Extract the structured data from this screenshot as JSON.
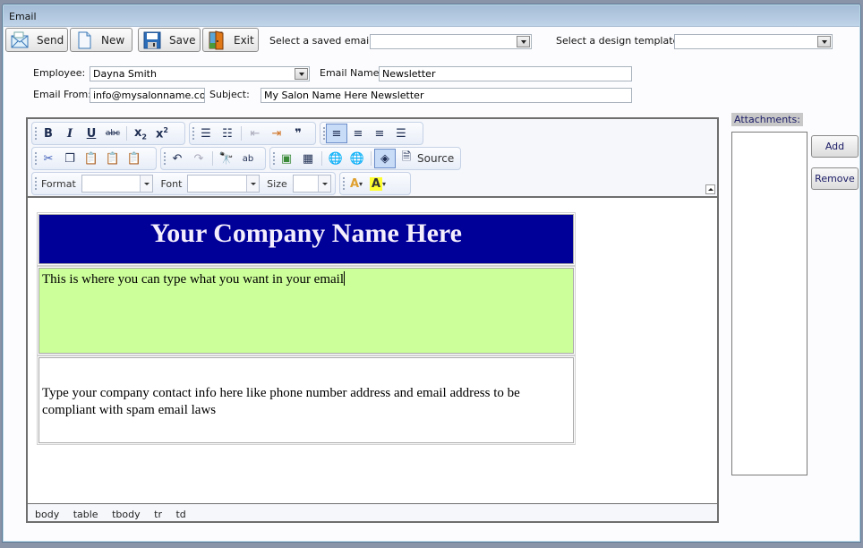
{
  "window": {
    "title": "Email"
  },
  "toolbar": {
    "send_label": "Send",
    "new_label": "New",
    "save_label": "Save",
    "exit_label": "Exit",
    "saved_email_label": "Select a saved email:",
    "saved_email_value": "",
    "design_template_label": "Select a design template:",
    "design_template_value": ""
  },
  "form": {
    "employee_label": "Employee:",
    "employee_value": "Dayna Smith",
    "email_name_label": "Email Name:",
    "email_name_value": "Newsletter",
    "email_from_label": "Email From:",
    "email_from_value": "info@mysalonname.com",
    "subject_label": "Subject:",
    "subject_value": "My Salon Name Here Newsletter"
  },
  "editor": {
    "toolbar_row1": [
      "bold-icon",
      "italic-icon",
      "underline-icon",
      "strikethrough-icon",
      "subscript-icon",
      "superscript-icon",
      "ordered-list-icon",
      "unordered-list-icon",
      "outdent-icon",
      "indent-icon",
      "blockquote-icon",
      "align-left-icon",
      "align-center-icon",
      "align-right-icon",
      "justify-icon"
    ],
    "toolbar_row2": [
      "cut-icon",
      "copy-icon",
      "paste-icon",
      "paste-text-icon",
      "paste-word-icon",
      "undo-icon",
      "redo-icon",
      "find-icon",
      "replace-icon",
      "image-icon",
      "table-icon",
      "link-icon",
      "unlink-icon",
      "show-blocks-icon",
      "source-icon"
    ],
    "bold": "B",
    "italic": "I",
    "underline": "U",
    "strike": "abc",
    "source_label": "Source",
    "format_label": "Format",
    "format_value": "",
    "font_label": "Font",
    "font_value": "",
    "size_label": "Size",
    "size_value": "",
    "content": {
      "header": "Your Company Name Here",
      "body": "This is where you can type what you want in your email",
      "footer": "Type your company contact info here like phone number address and email address to be compliant with spam email laws"
    },
    "path": [
      "body",
      "table",
      "tbody",
      "tr",
      "td"
    ]
  },
  "attachments": {
    "label": "Attachments:",
    "add_label": "Add",
    "remove_label": "Remove",
    "items": []
  },
  "colors": {
    "header_bg": "#000099",
    "body_bg": "#ccff99",
    "title_bar": "#b4c8e0"
  }
}
